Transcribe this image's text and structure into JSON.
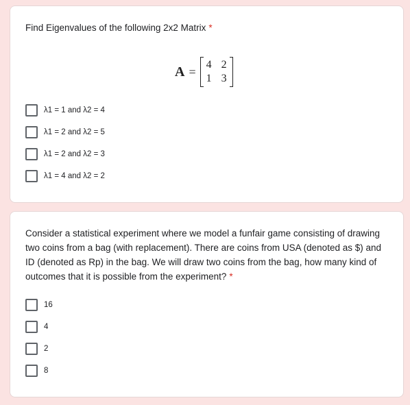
{
  "questions": [
    {
      "title": "Find Eigenvalues of the following 2x2 Matrix",
      "required_mark": "*",
      "matrix": {
        "name": "A",
        "equals": "=",
        "cells": [
          "4",
          "2",
          "1",
          "3"
        ]
      },
      "options": [
        "λ1 = 1 and λ2 = 4",
        "λ1 = 2 and λ2 = 5",
        "λ1 = 2 and λ2 = 3",
        "λ1 = 4 and λ2 = 2"
      ]
    },
    {
      "title": "Consider a statistical experiment where we model a funfair game consisting of drawing two coins from a bag (with replacement). There are coins from USA (denoted as $) and ID (denoted as Rp) in the bag. We will draw two coins from the bag, how many kind of outcomes that it is possible from the experiment?",
      "required_mark": "*",
      "options": [
        "16",
        "4",
        "2",
        "8"
      ]
    }
  ],
  "colors": {
    "background": "#fbe3e2",
    "card": "#ffffff",
    "required": "#d93025",
    "checkbox_border": "#5f6368"
  }
}
